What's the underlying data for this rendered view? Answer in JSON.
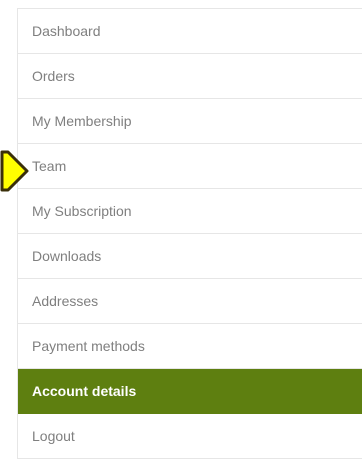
{
  "nav": {
    "items": [
      {
        "label": "Dashboard",
        "active": false
      },
      {
        "label": "Orders",
        "active": false
      },
      {
        "label": "My Membership",
        "active": false
      },
      {
        "label": "Team",
        "active": false
      },
      {
        "label": "My Subscription",
        "active": false
      },
      {
        "label": "Downloads",
        "active": false
      },
      {
        "label": "Addresses",
        "active": false
      },
      {
        "label": "Payment methods",
        "active": false
      },
      {
        "label": "Account details",
        "active": true
      },
      {
        "label": "Logout",
        "active": false
      }
    ]
  },
  "colors": {
    "active_background": "#5e7f10",
    "pointer_fill": "#ffff00",
    "pointer_stroke": "#3a2f0a"
  },
  "annotation": {
    "pointer_icon": "arrow-pointer-icon",
    "points_to": "Team"
  }
}
